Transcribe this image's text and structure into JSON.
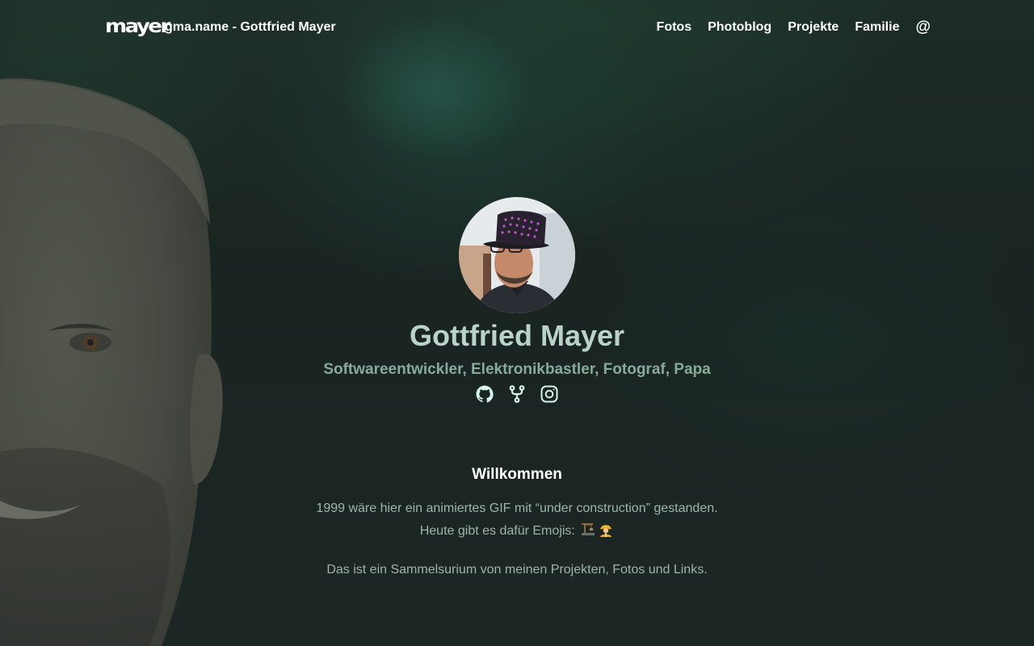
{
  "header": {
    "logo_text": "mayer",
    "site_title": "gma.name - Gottfried Mayer",
    "menu": [
      {
        "label": "Fotos"
      },
      {
        "label": "Photoblog"
      },
      {
        "label": "Projekte"
      },
      {
        "label": "Familie"
      },
      {
        "label": "@"
      }
    ]
  },
  "hero": {
    "avatar_icon": "profile-photo",
    "name": "Gottfried Mayer",
    "tagline": "Softwareentwickler, Elektronikbastler, Fotograf, Papa",
    "social_icons": [
      "github-icon",
      "git-fork-icon",
      "instagram-icon"
    ]
  },
  "content": {
    "heading": "Willkommen",
    "line1": "1999 wäre hier ein animiertes GIF mit “under construction” gestanden.",
    "line2": "Heute gibt es dafür Emojis:",
    "line2_emojis": [
      "building-construction-emoji",
      "construction-worker-emoji"
    ],
    "line3": "Das ist ein Sammelsurium von meinen Projekten, Fotos und Links."
  },
  "colors": {
    "background": "#1b2522",
    "name_text": "#b9d3ca",
    "tagline_text": "#88aa9c",
    "body_text": "#9cb5ab",
    "icon_accent": "#d8f2ec"
  }
}
